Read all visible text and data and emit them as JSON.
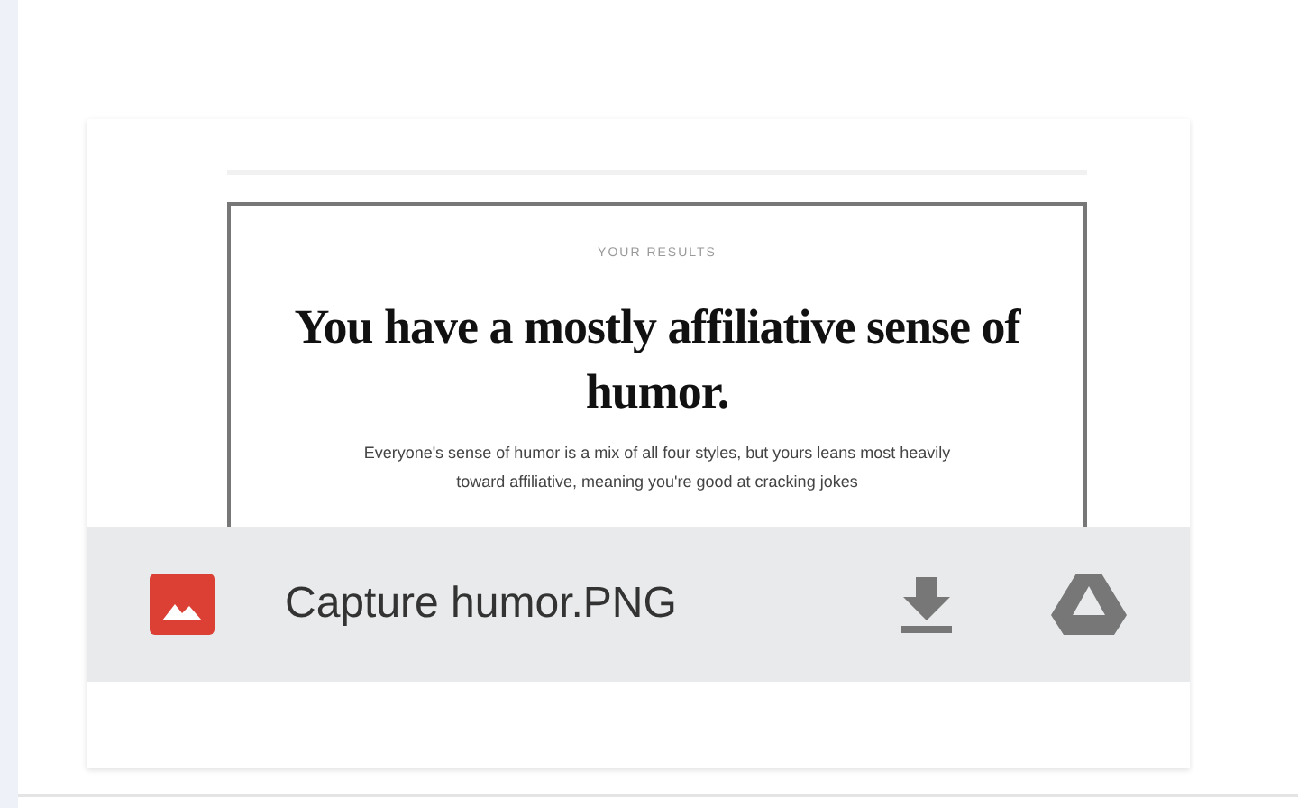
{
  "preview": {
    "eyebrow": "YOUR RESULTS",
    "title": "You have a mostly affiliative sense of humor.",
    "body": "Everyone's sense of humor is a mix of all four styles, but yours leans most heavily toward affiliative, meaning you're good at cracking jokes"
  },
  "file_bar": {
    "file_name": "Capture humor.PNG"
  }
}
